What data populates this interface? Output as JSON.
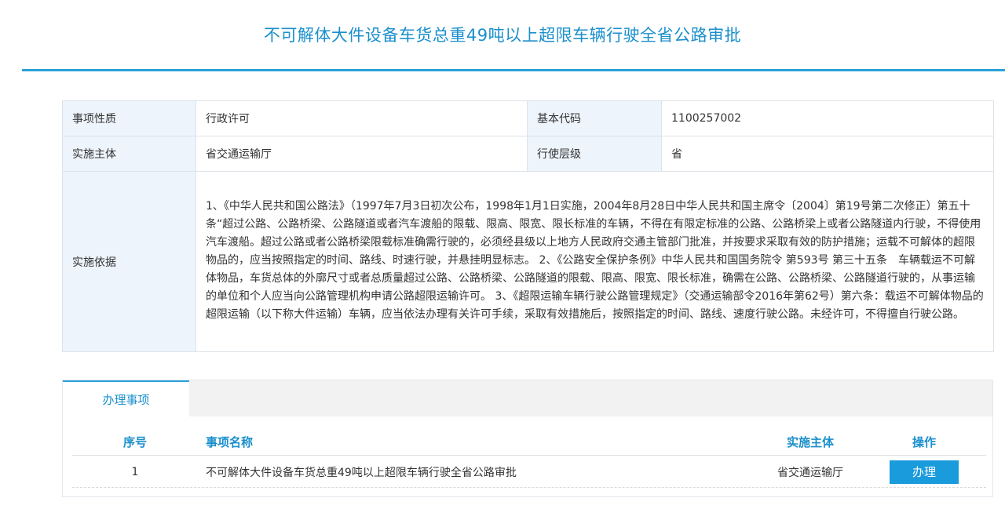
{
  "page": {
    "title": "不可解体大件设备车货总重49吨以上超限车辆行驶全省公路审批"
  },
  "info": {
    "nature_label": "事项性质",
    "nature_value": "行政许可",
    "code_label": "基本代码",
    "code_value": "1100257002",
    "subject_label": "实施主体",
    "subject_value": "省交通运输厅",
    "level_label": "行使层级",
    "level_value": "省",
    "basis_label": "实施依据",
    "basis_value": "1、《中华人民共和国公路法》（1997年7月3日初次公布，1998年1月1日实施，2004年8月28日中华人民共和国主席令〔2004〕第19号第二次修正）第五十条“超过公路、公路桥梁、公路隧道或者汽车渡船的限载、限高、限宽、限长标准的车辆，不得在有限定标准的公路、公路桥梁上或者公路隧道内行驶，不得使用汽车渡船。超过公路或者公路桥梁限载标准确需行驶的，必须经县级以上地方人民政府交通主管部门批准，并按要求采取有效的防护措施；运载不可解体的超限物品的，应当按照指定的时间、路线、时速行驶，并悬挂明显标志。 2、《公路安全保护条例》中华人民共和国国务院令 第593号 第三十五条　车辆载运不可解体物品，车货总体的外廓尺寸或者总质量超过公路、公路桥梁、公路隧道的限载、限高、限宽、限长标准，确需在公路、公路桥梁、公路隧道行驶的，从事运输的单位和个人应当向公路管理机构申请公路超限运输许可。 3、《超限运输车辆行驶公路管理规定》（交通运输部令2016年第62号）第六条：载运不可解体物品的超限运输（以下称大件运输）车辆，应当依法办理有关许可手续，采取有效措施后，按照指定的时间、路线、速度行驶公路。未经许可，不得擅自行驶公路。"
  },
  "handling": {
    "tab_label": "办理事项",
    "columns": {
      "index": "序号",
      "name": "事项名称",
      "subject": "实施主体",
      "operation": "操作"
    },
    "rows": [
      {
        "index": "1",
        "name": "不可解体大件设备车货总重49吨以上超限车辆行驶全省公路审批",
        "subject": "省交通运输厅",
        "action_label": "办理"
      }
    ]
  },
  "colors": {
    "accent": "#1a8fcc",
    "rule": "#2aa0d8",
    "label_bg": "#eef4fb",
    "button": "#1a9bdc"
  }
}
